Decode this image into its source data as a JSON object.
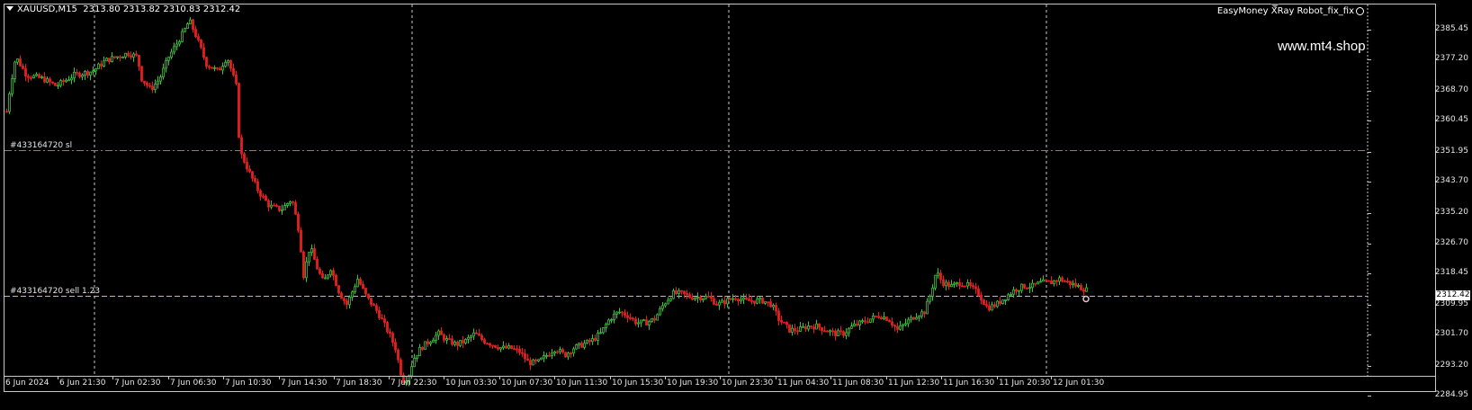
{
  "header": {
    "symbol": "XAUUSD,M15",
    "ohlc": "2313.80 2313.82 2310.83 2312.42"
  },
  "expert": {
    "name": "EasyMoney XRay Robot_fix_fix"
  },
  "watermark": "www.mt4.shop",
  "orders": [
    {
      "label": "#433164720 sl",
      "price": 2352.3,
      "color": "#3cb43c",
      "style": "dashdot"
    },
    {
      "label": "#433164720 sell 1.23",
      "price": 2312.42,
      "color": "#c8c832",
      "style": "dash"
    }
  ],
  "current_price": "2312.42",
  "colors": {
    "bull": "#32c832",
    "bear": "#e61e1e",
    "grid": "#c8c8c8",
    "background": "#000000"
  },
  "chart_data": {
    "type": "candlestick",
    "y_axis": {
      "range": [
        2284.95,
        2390
      ],
      "ticks": [
        "2385.45",
        "2377.20",
        "2368.70",
        "2360.45",
        "2351.95",
        "2343.70",
        "2335.20",
        "2326.70",
        "2318.45",
        "2309.95",
        "2301.70",
        "2293.20",
        "2284.95"
      ]
    },
    "x_axis": {
      "ticks": [
        "6 Jun 2024",
        "6 Jun 21:30",
        "7 Jun 02:30",
        "7 Jun 06:30",
        "7 Jun 10:30",
        "7 Jun 14:30",
        "7 Jun 18:30",
        "7 Jun 22:30",
        "10 Jun 03:30",
        "10 Jun 07:30",
        "10 Jun 11:30",
        "10 Jun 15:30",
        "10 Jun 19:30",
        "10 Jun 23:30",
        "11 Jun 04:30",
        "11 Jun 08:30",
        "11 Jun 12:30",
        "11 Jun 16:30",
        "11 Jun 20:30",
        "12 Jun 01:30"
      ],
      "vertical_separators": [
        "6 Jun 21:30",
        "7 Jun 22:30",
        "10 Jun 19:30",
        "12 Jun 01:30"
      ]
    },
    "price_path": [
      [
        0,
        2363
      ],
      [
        4,
        2370
      ],
      [
        10,
        2378
      ],
      [
        22,
        2373
      ],
      [
        40,
        2372
      ],
      [
        55,
        2370
      ],
      [
        75,
        2373
      ],
      [
        95,
        2374
      ],
      [
        110,
        2377
      ],
      [
        135,
        2379
      ],
      [
        145,
        2378
      ],
      [
        150,
        2372
      ],
      [
        160,
        2369
      ],
      [
        170,
        2372
      ],
      [
        180,
        2378
      ],
      [
        190,
        2382
      ],
      [
        197,
        2385
      ],
      [
        203,
        2388
      ],
      [
        210,
        2384
      ],
      [
        222,
        2376
      ],
      [
        235,
        2374
      ],
      [
        245,
        2378
      ],
      [
        255,
        2370
      ],
      [
        259,
        2352
      ],
      [
        263,
        2350
      ],
      [
        270,
        2346
      ],
      [
        280,
        2341
      ],
      [
        292,
        2337
      ],
      [
        305,
        2336
      ],
      [
        317,
        2339
      ],
      [
        325,
        2330
      ],
      [
        330,
        2318
      ],
      [
        337,
        2326
      ],
      [
        345,
        2320
      ],
      [
        352,
        2316
      ],
      [
        360,
        2320
      ],
      [
        370,
        2313
      ],
      [
        378,
        2310
      ],
      [
        390,
        2317
      ],
      [
        400,
        2312
      ],
      [
        412,
        2308
      ],
      [
        425,
        2302
      ],
      [
        432,
        2298
      ],
      [
        440,
        2289
      ],
      [
        446,
        2290
      ],
      [
        452,
        2295
      ],
      [
        460,
        2298
      ],
      [
        470,
        2300
      ],
      [
        480,
        2302
      ],
      [
        490,
        2300
      ],
      [
        500,
        2299
      ],
      [
        510,
        2300
      ],
      [
        520,
        2302
      ],
      [
        530,
        2300
      ],
      [
        540,
        2299
      ],
      [
        550,
        2298
      ],
      [
        560,
        2298
      ],
      [
        570,
        2297
      ],
      [
        580,
        2294
      ],
      [
        590,
        2294
      ],
      [
        600,
        2296
      ],
      [
        610,
        2298
      ],
      [
        620,
        2296
      ],
      [
        630,
        2298
      ],
      [
        640,
        2299
      ],
      [
        650,
        2300
      ],
      [
        660,
        2302
      ],
      [
        670,
        2306
      ],
      [
        680,
        2308
      ],
      [
        690,
        2307
      ],
      [
        700,
        2305
      ],
      [
        710,
        2305
      ],
      [
        720,
        2306
      ],
      [
        730,
        2310
      ],
      [
        740,
        2313
      ],
      [
        750,
        2313
      ],
      [
        760,
        2312
      ],
      [
        770,
        2312
      ],
      [
        780,
        2312
      ],
      [
        790,
        2310
      ],
      [
        800,
        2311
      ],
      [
        810,
        2312
      ],
      [
        820,
        2311
      ],
      [
        830,
        2311
      ],
      [
        840,
        2311
      ],
      [
        850,
        2310
      ],
      [
        858,
        2306
      ],
      [
        870,
        2303
      ],
      [
        880,
        2303
      ],
      [
        890,
        2304
      ],
      [
        900,
        2304
      ],
      [
        910,
        2303
      ],
      [
        920,
        2302
      ],
      [
        930,
        2302
      ],
      [
        940,
        2304
      ],
      [
        950,
        2305
      ],
      [
        960,
        2306
      ],
      [
        970,
        2307
      ],
      [
        980,
        2306
      ],
      [
        990,
        2303
      ],
      [
        1000,
        2305
      ],
      [
        1010,
        2307
      ],
      [
        1020,
        2308
      ],
      [
        1027,
        2313
      ],
      [
        1033,
        2319
      ],
      [
        1040,
        2316
      ],
      [
        1050,
        2315
      ],
      [
        1060,
        2316
      ],
      [
        1070,
        2315
      ],
      [
        1080,
        2313
      ],
      [
        1090,
        2309
      ],
      [
        1100,
        2310
      ],
      [
        1110,
        2312
      ],
      [
        1120,
        2314
      ],
      [
        1130,
        2315
      ],
      [
        1140,
        2315
      ],
      [
        1150,
        2316
      ],
      [
        1160,
        2316
      ],
      [
        1170,
        2317
      ],
      [
        1180,
        2316
      ],
      [
        1190,
        2315
      ],
      [
        1200,
        2314
      ],
      [
        1205,
        2312.4
      ]
    ]
  }
}
